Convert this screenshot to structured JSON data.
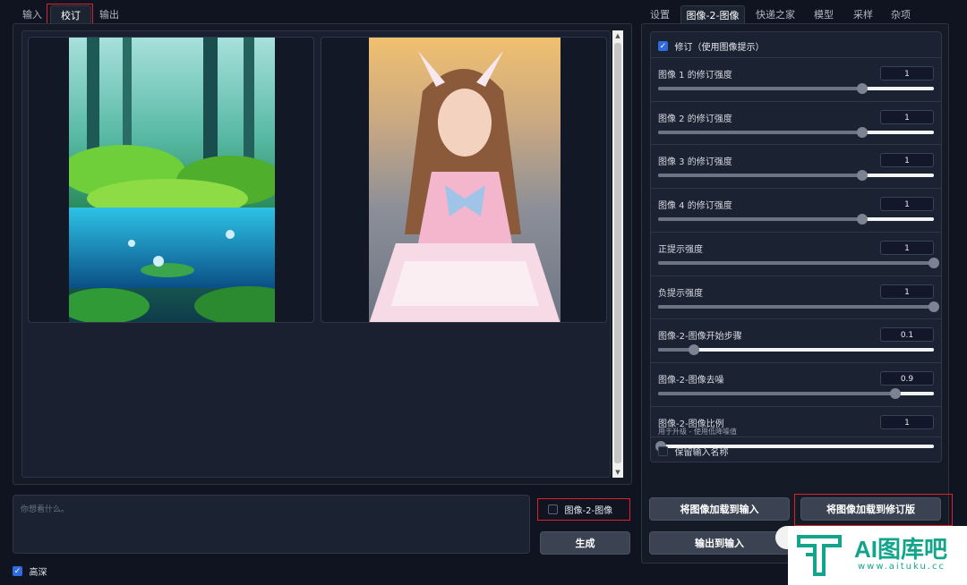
{
  "left_tabs": [
    "输入",
    "校订",
    "输出"
  ],
  "right_tabs": [
    "设置",
    "图像-2-图像",
    "快递之家",
    "模型",
    "采样",
    "杂项"
  ],
  "revise": {
    "checkbox_label": "修订（使用图像提示）",
    "checked": true,
    "sliders": [
      {
        "label": "图像 1 的修订强度",
        "value": "1",
        "fraction": 0.74
      },
      {
        "label": "图像 2 的修订强度",
        "value": "1",
        "fraction": 0.74
      },
      {
        "label": "图像 3 的修订强度",
        "value": "1",
        "fraction": 0.74
      },
      {
        "label": "图像 4 的修订强度",
        "value": "1",
        "fraction": 0.74
      },
      {
        "label": "正提示强度",
        "value": "1",
        "fraction": 1.0
      },
      {
        "label": "负提示强度",
        "value": "1",
        "fraction": 1.0
      },
      {
        "label": "图像-2-图像开始步骤",
        "value": "0.1",
        "fraction": 0.13
      },
      {
        "label": "图像-2-图像去噪",
        "value": "0.9",
        "fraction": 0.86
      },
      {
        "label": "图像-2-图像比例",
        "value": "1",
        "fraction": 0.01,
        "sublabel": "用于升级 - 使用低降噪值"
      }
    ],
    "keep_name_label": "保留输入名称"
  },
  "buttons": {
    "load_to_input": "将图像加载到输入",
    "load_to_revise": "将图像加载到修订版",
    "output_to_input": "输出到输入",
    "generate": "生成"
  },
  "prompt_placeholder": "你想看什么。",
  "img2img_checkbox": "图像-2-图像",
  "deep_checkbox": "高深",
  "watermark": {
    "brand": "AI图库吧",
    "url": "www.aituku.cc"
  },
  "colors": {
    "accent": "#2f6bdc",
    "highlight": "#e0202a",
    "logo": "#13a58c"
  }
}
